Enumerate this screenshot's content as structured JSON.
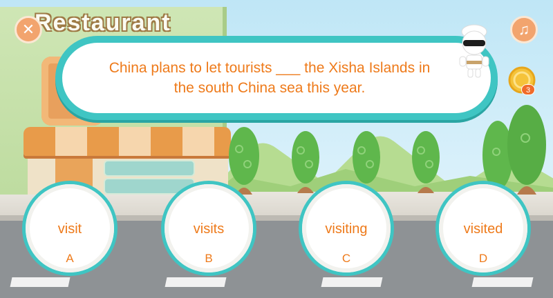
{
  "scene": {
    "sign_text": "Restaurant"
  },
  "question": {
    "text": "China plans to let tourists ___ the Xisha Islands in the south China sea this year."
  },
  "coins": {
    "count": "3"
  },
  "buttons": {
    "close_glyph": "✕",
    "music_glyph": "♫"
  },
  "options": [
    {
      "word": "visit",
      "letter": "A"
    },
    {
      "word": "visits",
      "letter": "B"
    },
    {
      "word": "visiting",
      "letter": "C"
    },
    {
      "word": "visited",
      "letter": "D"
    }
  ],
  "colors": {
    "accent": "#3fc5c3",
    "text": "#ee7a1a",
    "button": "#f2a46e"
  }
}
